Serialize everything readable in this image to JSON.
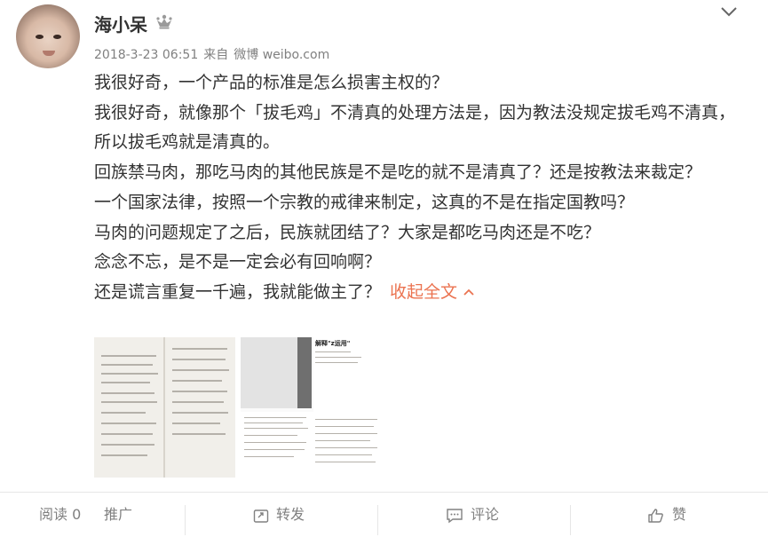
{
  "post": {
    "author": "海小呆",
    "crown_icon": "crown-icon",
    "timestamp": "2018-3-23 06:51",
    "source_prefix": "来自",
    "source": "微博 weibo.com",
    "paragraphs": [
      "我很好奇，一个产品的标准是怎么损害主权的？",
      "我很好奇，就像那个「拔毛鸡」不清真的处理方法是，因为教法没规定拔毛鸡不清真，所以拔毛鸡就是清真的。",
      "回族禁马肉，那吃马肉的其他民族是不是吃的就不是清真了？还是按教法来裁定？",
      "一个国家法律，按照一个宗教的戒律来制定，这真的不是在指定国教吗？",
      "马肉的问题规定了之后，民族就团结了？大家是都吃马肉还是不吃？",
      "念念不忘，是不是一定会必有回响啊？",
      "还是谎言重复一千遍，我就能做主了？"
    ],
    "collapse_label": "收起全文",
    "images": [
      {
        "kind": "book page scan"
      },
      {
        "kind": "book cover scan",
        "title_text": "解释\"z运用\""
      }
    ]
  },
  "footer": {
    "read_label": "阅读",
    "read_count": "0",
    "promote_label": "推广",
    "forward_label": "转发",
    "comment_label": "评论",
    "like_label": "赞"
  },
  "colors": {
    "accent": "#eb7350",
    "text": "#333333",
    "muted": "#808080",
    "divider": "#e6e6e6"
  }
}
